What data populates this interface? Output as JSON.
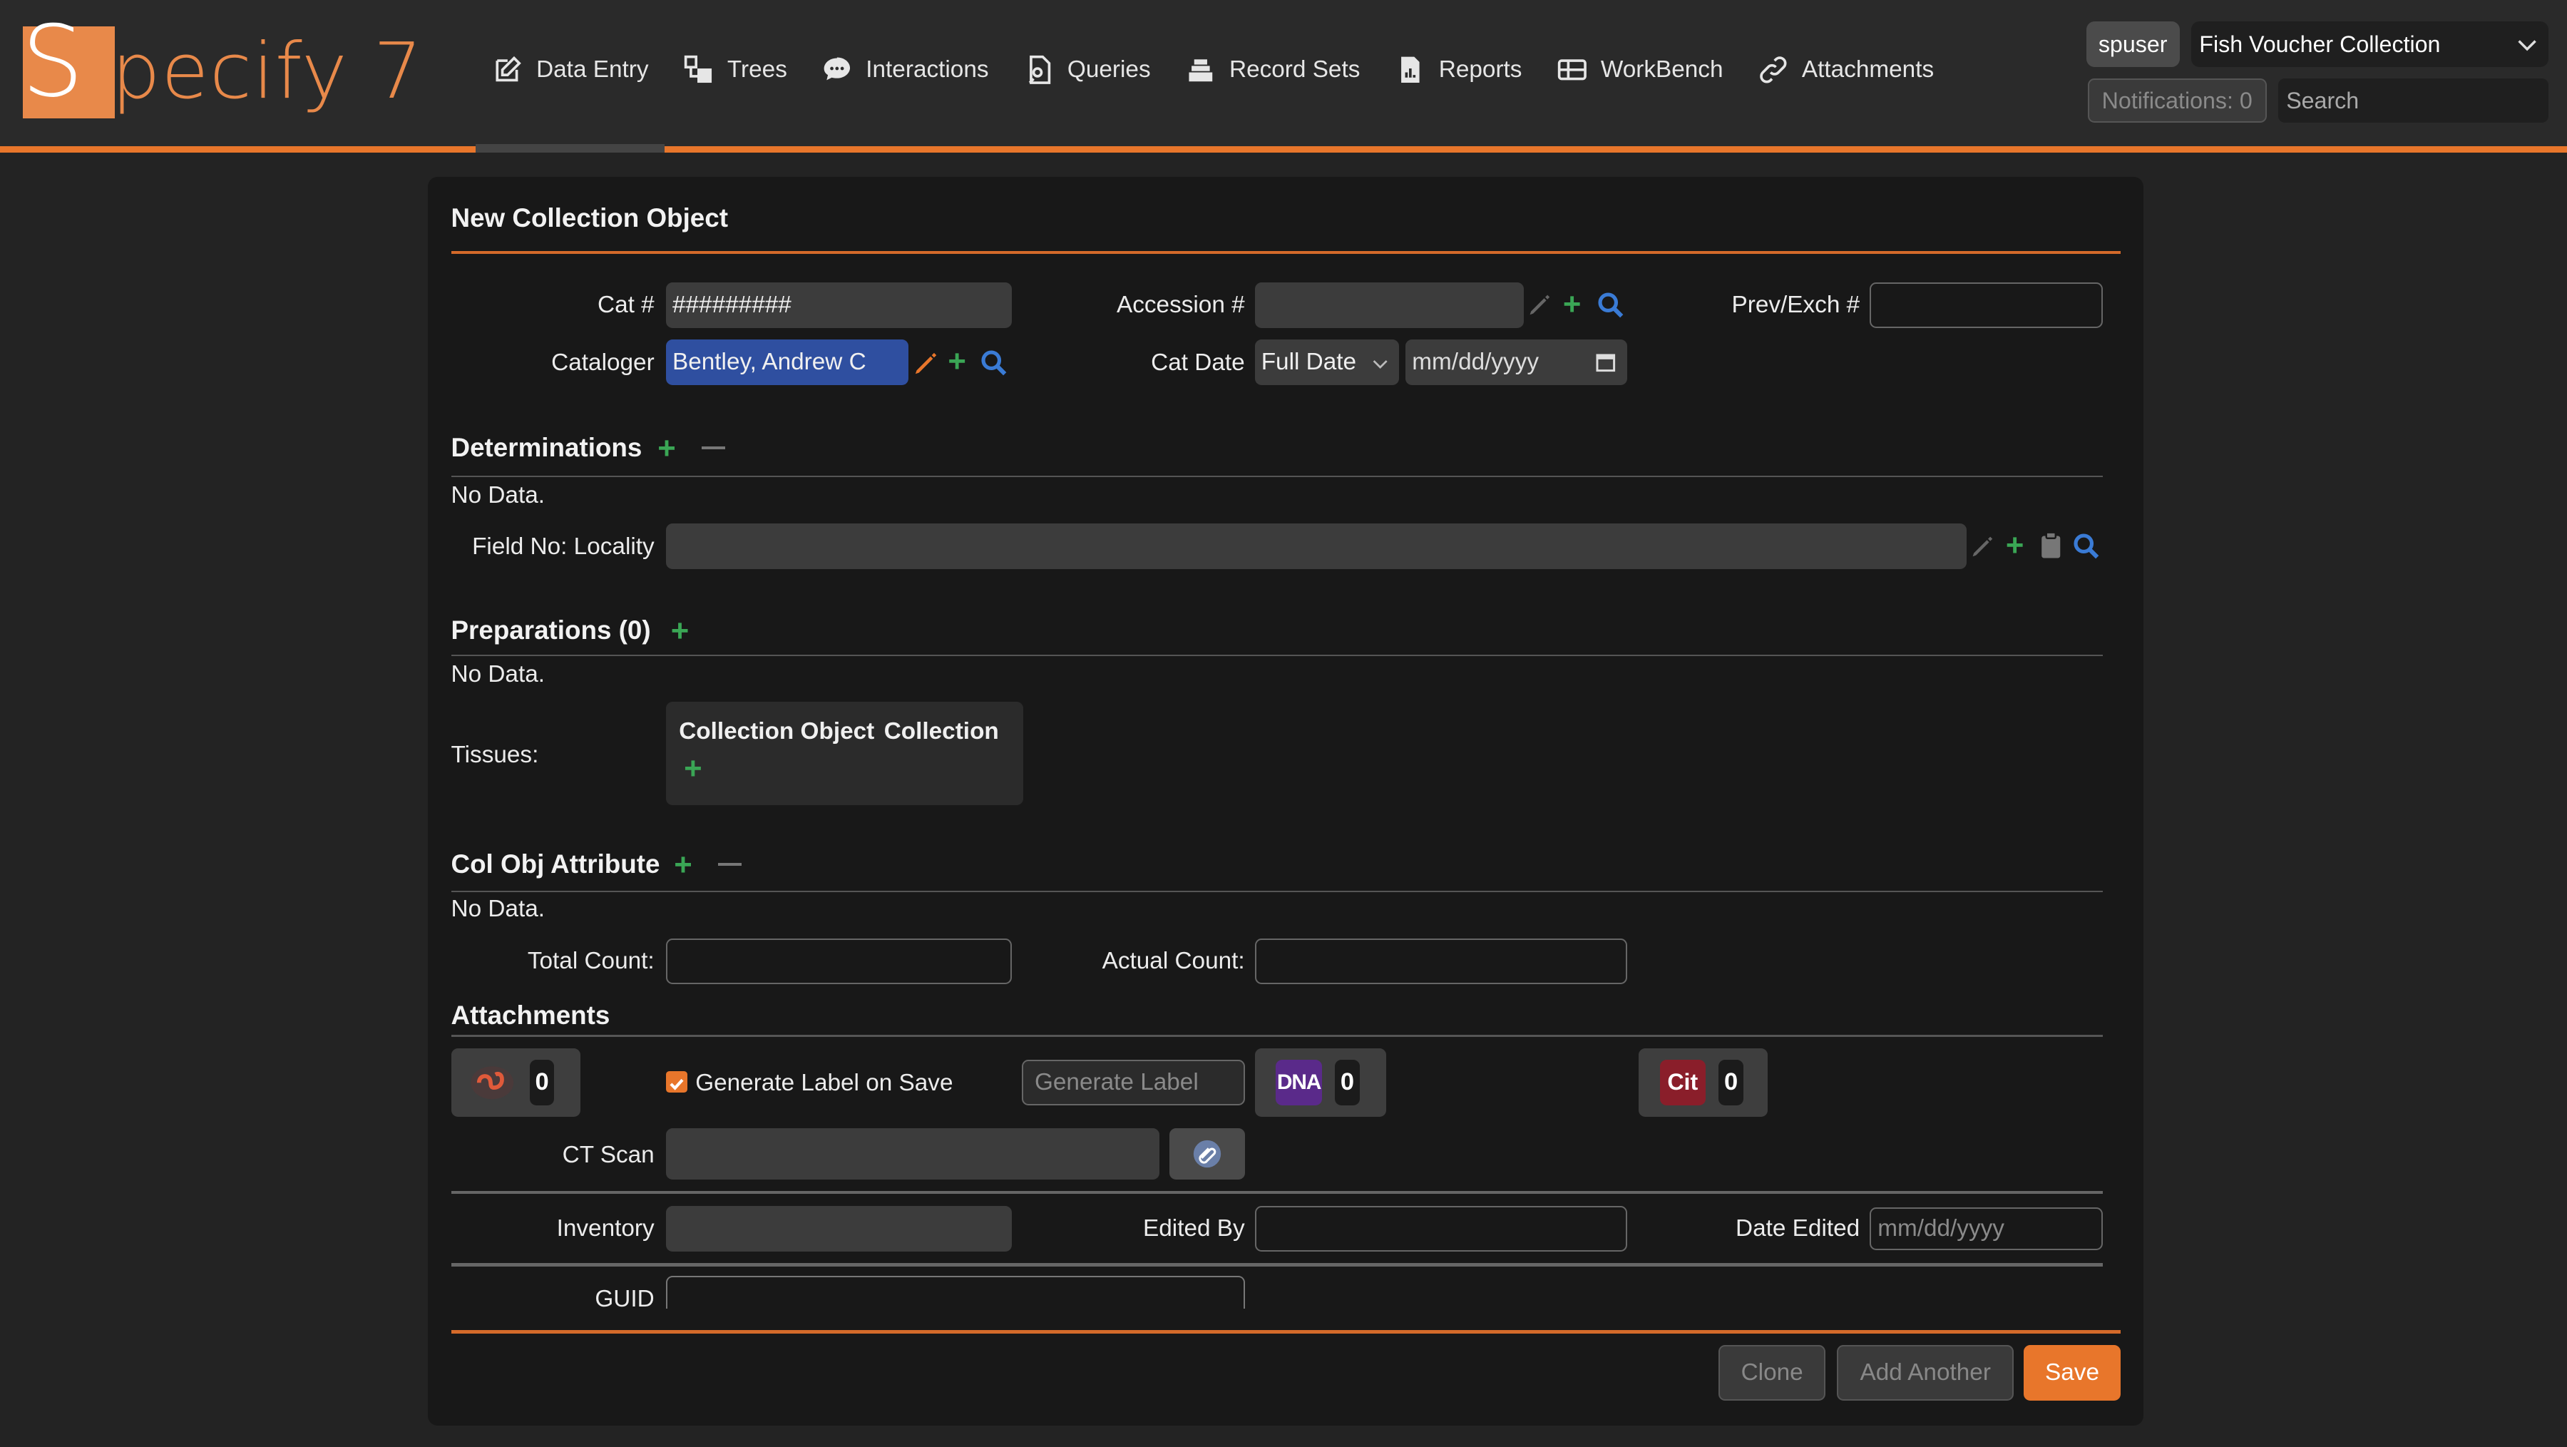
{
  "app": {
    "logo_text": "Specify 7",
    "logo_s": "S",
    "logo_rest": "pecify 7"
  },
  "nav": {
    "items": [
      {
        "label": "Data Entry",
        "icon": "pencil-square-icon"
      },
      {
        "label": "Trees",
        "icon": "tree-nodes-icon"
      },
      {
        "label": "Interactions",
        "icon": "chat-bubble-icon"
      },
      {
        "label": "Queries",
        "icon": "query-icon"
      },
      {
        "label": "Record Sets",
        "icon": "stack-icon"
      },
      {
        "label": "Reports",
        "icon": "document-chart-icon"
      },
      {
        "label": "WorkBench",
        "icon": "table-icon"
      },
      {
        "label": "Attachments",
        "icon": "link-icon"
      }
    ]
  },
  "header": {
    "user": "spuser",
    "collection": "Fish Voucher Collection",
    "notifications": "Notifications: 0",
    "search_placeholder": "Search"
  },
  "form": {
    "title": "New Collection Object",
    "cat_num_label": "Cat #",
    "cat_num_value": "#########",
    "accession_label": "Accession #",
    "accession_value": "",
    "prev_exch_label": "Prev/Exch #",
    "cataloger_label": "Cataloger",
    "cataloger_value": "Bentley, Andrew C",
    "cat_date_label": "Cat Date",
    "cat_date_precision": "Full Date",
    "cat_date_placeholder": "mm/dd/yyyy",
    "determinations_title": "Determinations",
    "no_data": "No Data.",
    "locality_label": "Field No: Locality",
    "preparations_title": "Preparations (0)",
    "tissues_label": "Tissues:",
    "tissues_col1": "Collection Object",
    "tissues_col2": "Collection",
    "colobj_attr_title": "Col Obj Attribute",
    "total_count_label": "Total Count:",
    "actual_count_label": "Actual Count:",
    "attachments_title": "Attachments",
    "att_count_1": "0",
    "att_count_dna": "0",
    "att_count_cit": "0",
    "dna_badge": "DNA",
    "cit_badge": "Cit",
    "generate_label_checkbox": "Generate Label on Save",
    "generate_label_placeholder": "Generate Label",
    "ct_scan_label": "CT Scan",
    "inventory_label": "Inventory",
    "edited_by_label": "Edited By",
    "date_edited_label": "Date Edited",
    "date_edited_placeholder": "mm/dd/yyyy",
    "guid_label": "GUID"
  },
  "buttons": {
    "clone": "Clone",
    "add_another": "Add Another",
    "save": "Save"
  },
  "colors": {
    "accent": "#e8762b",
    "add_green": "#3aa655",
    "query_blue": "#3a7bd5",
    "selected_field_blue": "#2f4fa0"
  }
}
